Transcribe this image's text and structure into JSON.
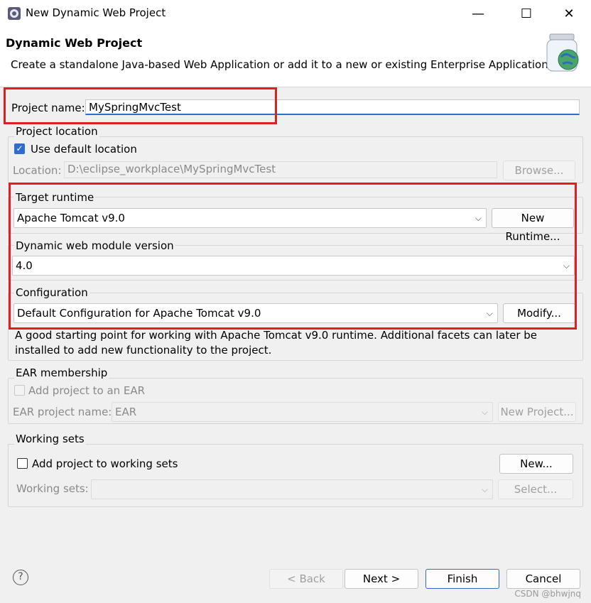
{
  "window": {
    "title": "New Dynamic Web Project",
    "minimize": "—",
    "maximize": "☐",
    "close": "✕"
  },
  "header": {
    "title": "Dynamic Web Project",
    "description": "Create a standalone Java-based Web Application or add it to a new or existing Enterprise Application."
  },
  "project_name": {
    "label": "Project name:",
    "value": "MySpringMvcTest"
  },
  "project_location": {
    "group_label": "Project location",
    "use_default_label": "Use default location",
    "use_default_checked": true,
    "location_label": "Location:",
    "location_value": "D:\\eclipse_workplace\\MySpringMvcTest",
    "browse_label": "Browse..."
  },
  "target_runtime": {
    "label": "Target runtime",
    "value": "Apache Tomcat v9.0",
    "new_runtime_label": "New Runtime..."
  },
  "module_version": {
    "label": "Dynamic web module version",
    "value": "4.0"
  },
  "configuration": {
    "label": "Configuration",
    "value": "Default Configuration for Apache Tomcat v9.0",
    "modify_label": "Modify...",
    "description": "A good starting point for working with Apache Tomcat v9.0 runtime. Additional facets can later be installed to add new functionality to the project."
  },
  "ear": {
    "group_label": "EAR membership",
    "add_label": "Add project to an EAR",
    "project_name_label": "EAR project name:",
    "project_name_value": "EAR",
    "new_project_label": "New Project..."
  },
  "working_sets": {
    "group_label": "Working sets",
    "add_label": "Add project to working sets",
    "new_label": "New...",
    "sets_label": "Working sets:",
    "select_label": "Select..."
  },
  "footer": {
    "help": "?",
    "back": "< Back",
    "next": "Next >",
    "finish": "Finish",
    "cancel": "Cancel"
  },
  "watermark": "CSDN @bhwjnq",
  "colors": {
    "accent": "#2f6bd0",
    "highlight": "#e02020"
  }
}
